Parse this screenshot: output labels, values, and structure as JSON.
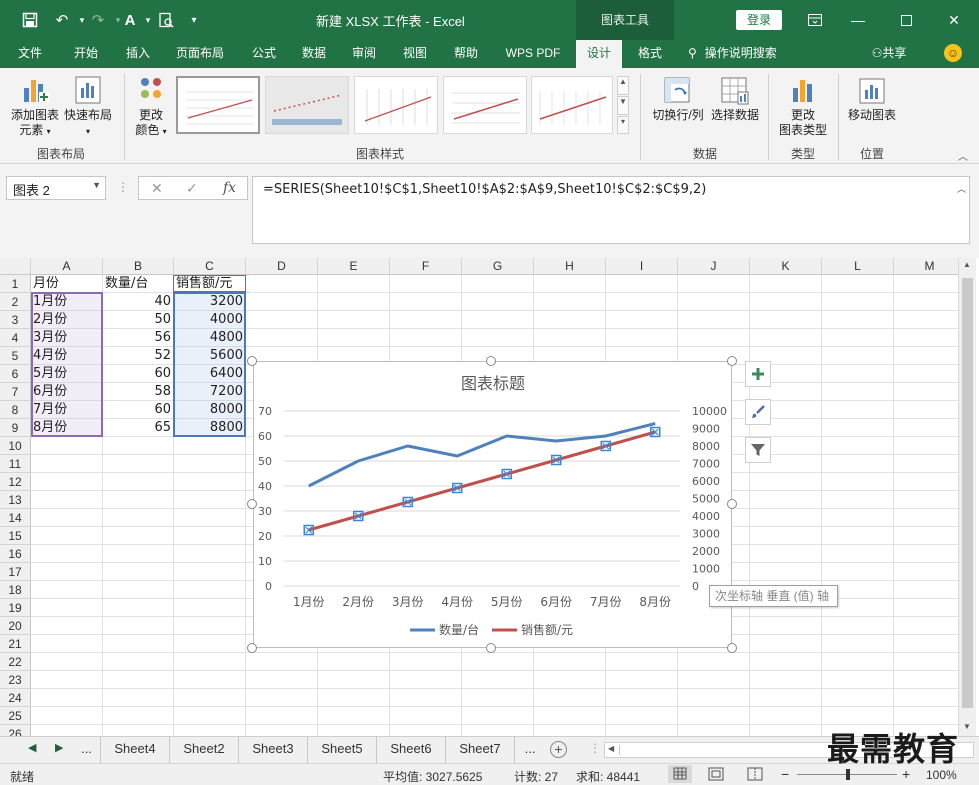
{
  "titlebar": {
    "title": "新建 XLSX 工作表  -  Excel",
    "chart_tools": "图表工具",
    "login": "登录"
  },
  "tabs": [
    "文件",
    "开始",
    "插入",
    "页面布局",
    "公式",
    "数据",
    "审阅",
    "视图",
    "帮助",
    "WPS PDF",
    "设计",
    "格式"
  ],
  "tell_me": "操作说明搜索",
  "share": "共享",
  "ribbon": {
    "add_element": "添加图表",
    "add_element2": "元素",
    "quick_layout": "快速布局",
    "change_colors": "更改",
    "change_colors2": "颜色",
    "group_layout": "图表布局",
    "group_styles": "图表样式",
    "switch_rowcol": "切换行/列",
    "select_data": "选择数据",
    "group_data": "数据",
    "change_type": "更改",
    "change_type2": "图表类型",
    "group_type": "类型",
    "move_chart": "移动图表",
    "group_location": "位置"
  },
  "namebox": "图表 2",
  "formula": "=SERIES(Sheet10!$C$1,Sheet10!$A$2:$A$9,Sheet10!$C$2:$C$9,2)",
  "columns": [
    "A",
    "B",
    "C",
    "D",
    "E",
    "F",
    "G",
    "H",
    "I",
    "J",
    "K",
    "L",
    "M"
  ],
  "rows": [
    "1",
    "2",
    "3",
    "4",
    "5",
    "6",
    "7",
    "8",
    "9",
    "10",
    "11",
    "12",
    "13",
    "14",
    "15",
    "16",
    "17",
    "18",
    "19",
    "20",
    "21",
    "22",
    "23",
    "24",
    "25",
    "26"
  ],
  "table": {
    "headers": [
      "月份",
      "数量/台",
      "销售额/元"
    ],
    "months": [
      "1月份",
      "2月份",
      "3月份",
      "4月份",
      "5月份",
      "6月份",
      "7月份",
      "8月份"
    ],
    "qty": [
      "40",
      "50",
      "56",
      "52",
      "60",
      "58",
      "60",
      "65"
    ],
    "sales": [
      "3200",
      "4000",
      "4800",
      "5600",
      "6400",
      "7200",
      "8000",
      "8800"
    ]
  },
  "chart_data": {
    "type": "line",
    "title": "图表标题",
    "categories": [
      "1月份",
      "2月份",
      "3月份",
      "4月份",
      "5月份",
      "6月份",
      "7月份",
      "8月份"
    ],
    "series": [
      {
        "name": "数量/台",
        "values": [
          40,
          50,
          56,
          52,
          60,
          58,
          60,
          65
        ],
        "axis": "primary",
        "color": "#4f81bd"
      },
      {
        "name": "销售额/元",
        "values": [
          3200,
          4000,
          4800,
          5600,
          6400,
          7200,
          8000,
          8800
        ],
        "axis": "secondary",
        "color": "#c0504d"
      }
    ],
    "ylim": [
      0,
      70
    ],
    "yticks": [
      "0",
      "10",
      "20",
      "30",
      "40",
      "50",
      "60",
      "70"
    ],
    "y2lim": [
      0,
      10000
    ],
    "y2ticks": [
      "0",
      "1000",
      "2000",
      "3000",
      "4000",
      "5000",
      "6000",
      "7000",
      "8000",
      "9000",
      "10000"
    ],
    "grid": true,
    "legend": "bottom"
  },
  "tooltip": "次坐标轴 垂直 (值) 轴",
  "sheets": [
    "Sheet4",
    "Sheet2",
    "Sheet3",
    "Sheet5",
    "Sheet6",
    "Sheet7"
  ],
  "ellipsis": "...",
  "status": {
    "ready": "就绪",
    "average": "平均值: 3027.5625",
    "count": "计数: 27",
    "sum": "求和: 48441",
    "zoom": "100%"
  },
  "watermark": "最需教育"
}
